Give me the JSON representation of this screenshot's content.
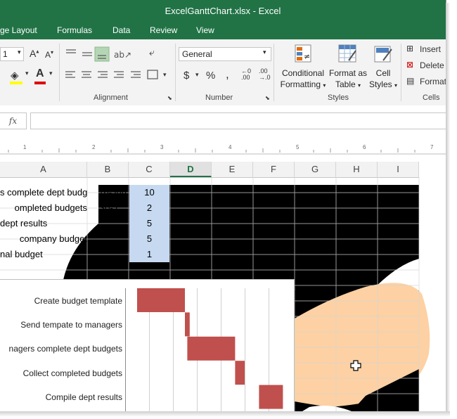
{
  "window": {
    "title": "ExcelGanttChart.xlsx - Excel"
  },
  "ribbon_tabs": [
    "ge Layout",
    "Formulas",
    "Data",
    "Review",
    "View"
  ],
  "ribbon": {
    "font_size": "1",
    "number_format": "General",
    "groups": {
      "alignment": "Alignment",
      "number": "Number",
      "styles": "Styles",
      "cells": "Cells"
    },
    "conditional": [
      "Conditional",
      "Formatting"
    ],
    "format_table": [
      "Format as",
      "Table"
    ],
    "cell_styles": [
      "Cell",
      "Styles"
    ],
    "insert": "Insert",
    "delete": "Delete",
    "format": "Format",
    "currency": "$",
    "percent": "%",
    "comma": ","
  },
  "formula_bar": {
    "fx": "fx",
    "value": ""
  },
  "ruler_ticks": [
    "1",
    "2",
    "3",
    "4",
    "5",
    "6",
    "7"
  ],
  "columns": [
    "A",
    "B",
    "C",
    "D",
    "E",
    "F",
    "G",
    "H",
    "I"
  ],
  "rows": [
    {
      "a": "s complete dept budge",
      "b": "16-Jun",
      "c": "10"
    },
    {
      "a": "ompleted budgets",
      "b": "30-J",
      "c": "2"
    },
    {
      "a": "dept results",
      "b": "",
      "c": "5"
    },
    {
      "a": "company budget",
      "b": "",
      "c": "5"
    },
    {
      "a": "nal budget",
      "b": "",
      "c": "1"
    }
  ],
  "chart_data": {
    "type": "bar",
    "orientation": "horizontal",
    "categories": [
      "Create budget template",
      "Send tempate to managers",
      "nagers complete dept budgets",
      "Collect completed budgets",
      "Compile dept results"
    ],
    "series": [
      {
        "values": [
          2,
          0.2,
          2,
          0.4,
          1
        ],
        "start": [
          0.5,
          2.5,
          2.6,
          4.6,
          5.6
        ],
        "color": "#c0504d"
      }
    ],
    "xlim": [
      0,
      7
    ],
    "grid": true
  },
  "colors": {
    "accent": "#217346",
    "bar": "#c0504d",
    "selection": "#c6d9f1",
    "skin": "#fdd1a3"
  }
}
